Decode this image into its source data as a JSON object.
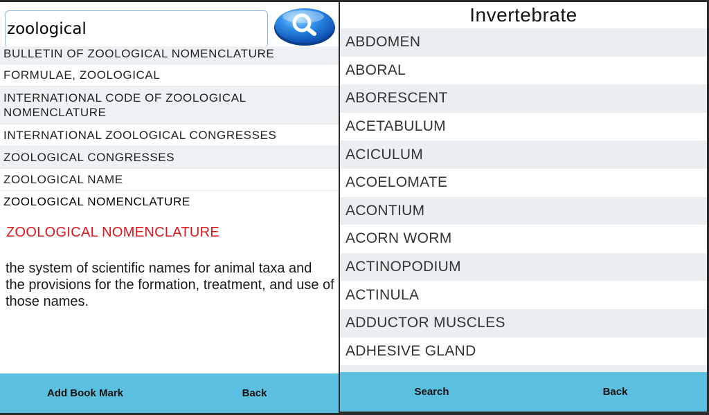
{
  "search": {
    "value": "zoological"
  },
  "results": [
    {
      "label": "BULLETIN OF ZOOLOGICAL NOMENCLATURE"
    },
    {
      "label": "FORMULAE, ZOOLOGICAL"
    },
    {
      "label": "INTERNATIONAL CODE OF ZOOLOGICAL NOMENCLATURE"
    },
    {
      "label": "INTERNATIONAL ZOOLOGICAL CONGRESSES"
    },
    {
      "label": "ZOOLOGICAL CONGRESSES"
    },
    {
      "label": "ZOOLOGICAL NAME"
    },
    {
      "label": "ZOOLOGICAL NOMENCLATURE"
    }
  ],
  "definition": {
    "title": "ZOOLOGICAL NOMENCLATURE",
    "text": "the system of scientific names for animal taxa and the provisions for the formation, treatment, and use of those names."
  },
  "left_bar": {
    "bookmark_label": "Add Book Mark",
    "back_label": "Back"
  },
  "right_panel": {
    "title": "Invertebrate",
    "terms": [
      "ABDOMEN",
      "ABORAL",
      "ABORESCENT",
      "ACETABULUM",
      "ACICULUM",
      "ACOELOMATE",
      "ACONTIUM",
      "ACORN WORM",
      "ACTINOPODIUM",
      "ACTINULA",
      "ADDUCTOR MUSCLES",
      "ADHESIVE GLAND"
    ]
  },
  "right_bar": {
    "search_label": "Search",
    "back_label": "Back"
  },
  "colors": {
    "bottom_bar": "#5bbfe0",
    "definition_title": "#e0141b",
    "row_shade": "#ebeef1"
  },
  "icons": {
    "search_button": "magnifier-icon"
  }
}
